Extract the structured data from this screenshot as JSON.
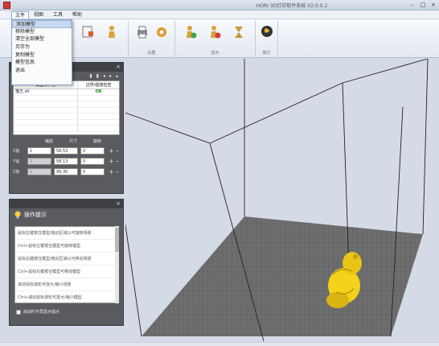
{
  "window": {
    "title": "HORI 3D打印软件系统 V2.0.0.2"
  },
  "menubar": {
    "items": [
      "文件",
      "视图",
      "工具",
      "帮助"
    ]
  },
  "file_menu": {
    "items": [
      "添加模型",
      "移除模型",
      "清空全部模型",
      "另存为",
      "复制模型",
      "模型信息",
      "退出"
    ]
  },
  "ribbon": {
    "groups": [
      "设置",
      "显示",
      "其它"
    ]
  },
  "model_panel": {
    "columns": [
      "模型文件名",
      "边界/碰撞检查"
    ],
    "rows": [
      {
        "name": "猫王.stl",
        "status": "OK"
      }
    ],
    "dims_headers": [
      "缩放",
      "尺寸",
      "旋转"
    ],
    "axes": [
      {
        "label": "X轴",
        "scale": "1",
        "size": "56.53",
        "rotate": "0"
      },
      {
        "label": "Y轴",
        "scale": "1",
        "size": "58.13",
        "rotate": "0"
      },
      {
        "label": "Z轴",
        "scale": "1",
        "size": "99.30",
        "rotate": "0"
      }
    ]
  },
  "tips_panel": {
    "title": "操作提示",
    "tips": [
      "鼠标左键按住模型/拖动区域以可旋转场景",
      "Ctrl+鼠标左键按住模型可旋转模型",
      "鼠标右键按住模型/拖动区域以可移动场景",
      "Ctrl+鼠标右键按住模型可移动模型",
      "滚动鼠标滚轮可放大/缩小场景",
      "Ctrl+滚动鼠标滚轮可放大/缩小模型"
    ],
    "checkbox_label": "启动时不再显示提示"
  },
  "colors": {
    "accent": "#8da9cf",
    "panel": "#595b5e",
    "model": "#f2d21a",
    "bed": "#6e6e6e"
  }
}
